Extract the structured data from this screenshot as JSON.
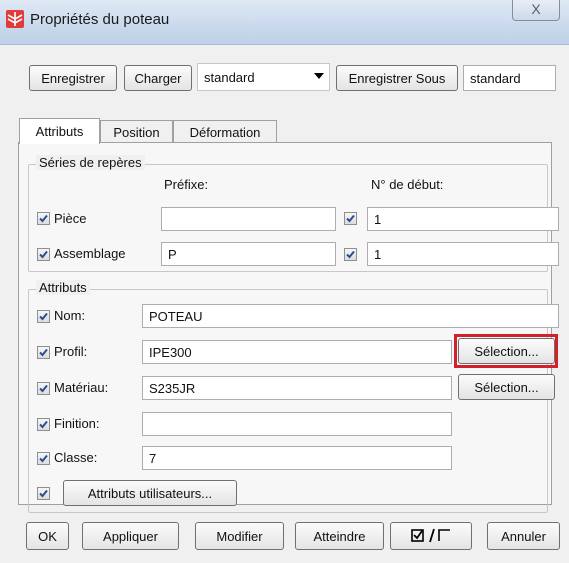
{
  "window": {
    "title": "Propriétés du poteau",
    "close_glyph": "X"
  },
  "toolbar": {
    "save_label": "Enregistrer",
    "load_label": "Charger",
    "preset_value": "standard",
    "save_as_label": "Enregistrer Sous",
    "save_as_value": "standard"
  },
  "tabs": [
    {
      "label": "Attributs",
      "active": true
    },
    {
      "label": "Position",
      "active": false
    },
    {
      "label": "Déformation",
      "active": false
    }
  ],
  "numbering": {
    "group_title": "Séries de repères",
    "prefix_header": "Préfixe:",
    "start_header": "N° de début:",
    "rows": [
      {
        "label": "Pièce",
        "checked": true,
        "prefix": "",
        "start_checked": true,
        "start": "1"
      },
      {
        "label": "Assemblage",
        "checked": true,
        "prefix": "P",
        "start_checked": true,
        "start": "1"
      }
    ]
  },
  "attributes": {
    "group_title": "Attributs",
    "name_label": "Nom:",
    "name_value": "POTEAU",
    "profile_label": "Profil:",
    "profile_value": "IPE300",
    "profile_select": "Sélection...",
    "material_label": "Matériau:",
    "material_value": "S235JR",
    "material_select": "Sélection...",
    "finish_label": "Finition:",
    "finish_value": "",
    "class_label": "Classe:",
    "class_value": "7",
    "user_attrs_label": "Attributs utilisateurs..."
  },
  "footer": {
    "ok": "OK",
    "apply": "Appliquer",
    "modify": "Modifier",
    "reach": "Atteindre",
    "cancel": "Annuler"
  },
  "colors": {
    "highlight": "#d4202a",
    "check": "#2a4f8f"
  }
}
